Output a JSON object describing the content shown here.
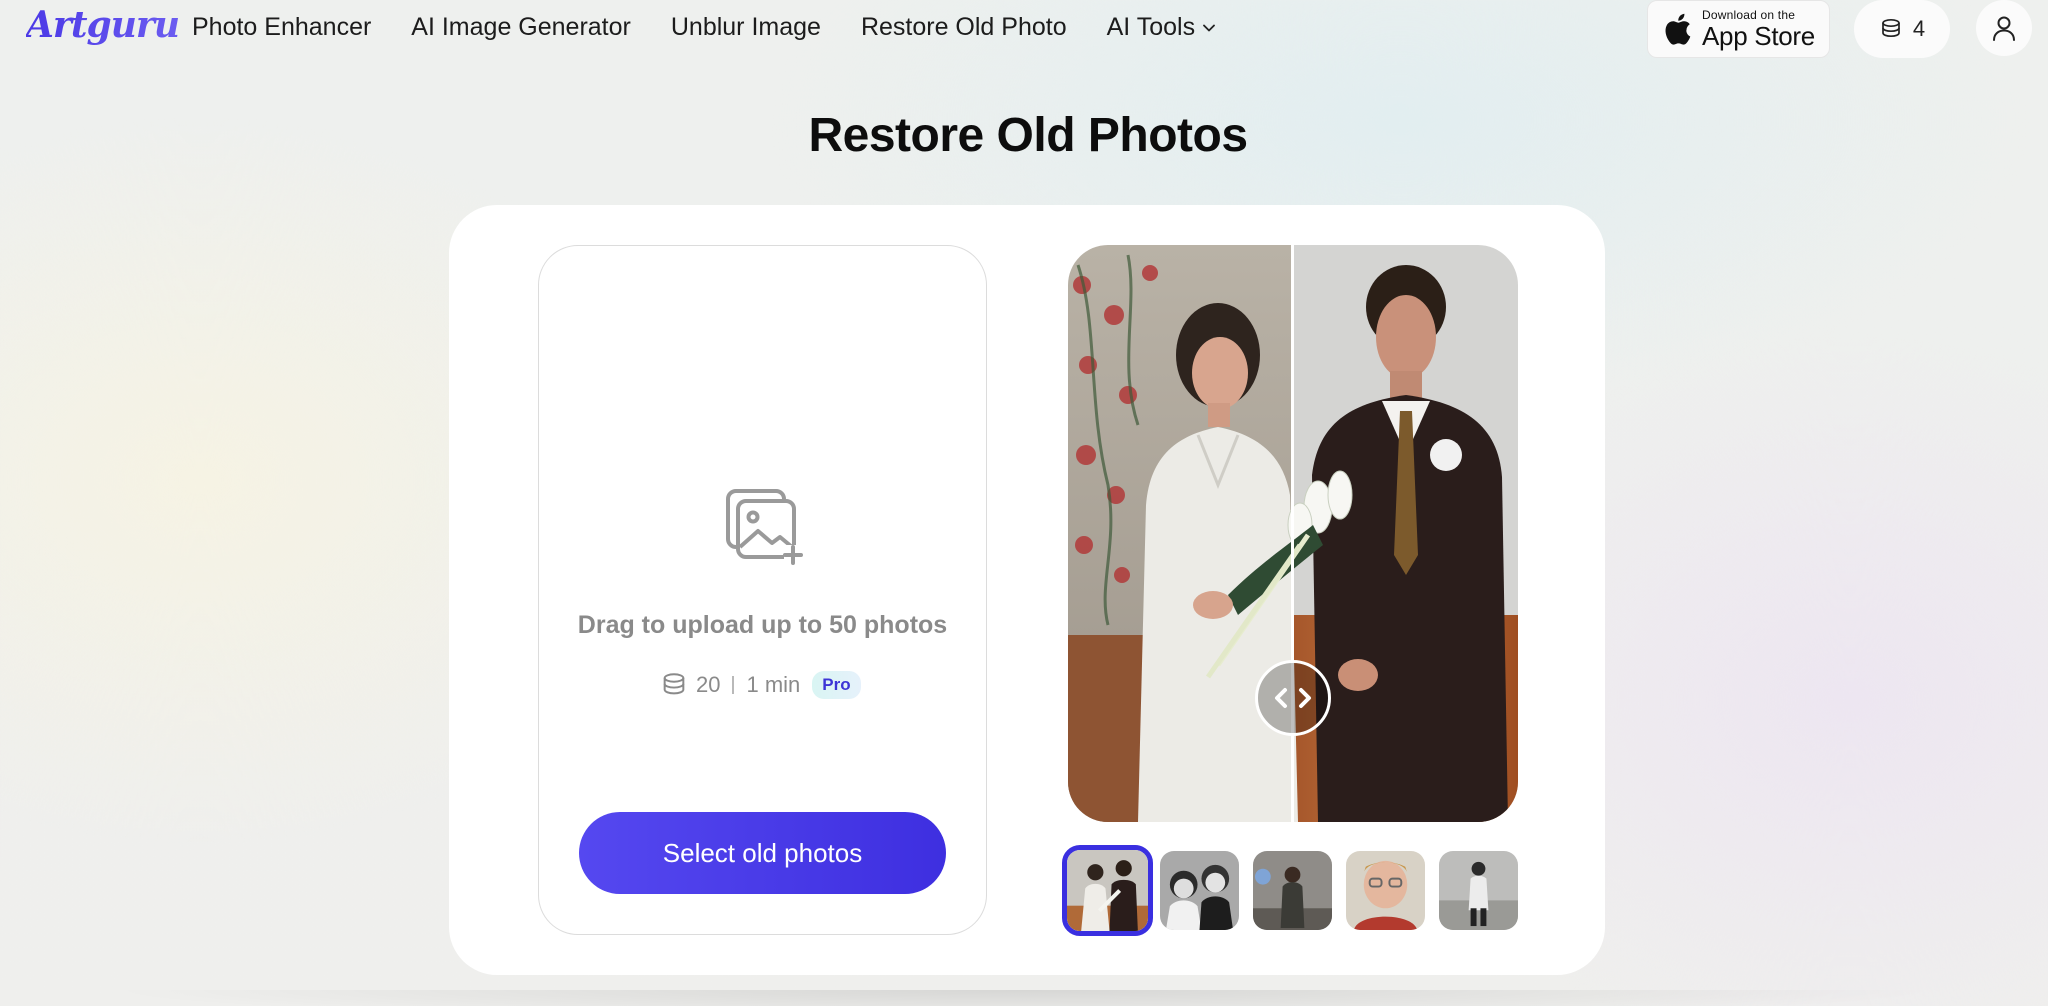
{
  "header": {
    "logo": "Artguru",
    "nav": [
      {
        "label": "Photo Enhancer"
      },
      {
        "label": "AI Image Generator"
      },
      {
        "label": "Unblur Image"
      },
      {
        "label": "Restore Old Photo"
      },
      {
        "label": "AI Tools"
      }
    ],
    "app_store": {
      "line1": "Download on the",
      "line2": "App Store"
    },
    "credits": "4"
  },
  "title": "Restore Old Photos",
  "upload": {
    "text": "Drag to upload up to 50 photos",
    "cost": "20",
    "time": "1 min",
    "badge": "Pro",
    "button": "Select old photos"
  },
  "comparison": {
    "divider_position_fraction": 0.5
  },
  "thumbnails": {
    "count": 5,
    "selected_index": 0
  },
  "colors": {
    "accent": "#4b39e6",
    "button": "#4a3ce8",
    "badge_text": "#3d35d6"
  },
  "icons": [
    "apple-icon",
    "coins-icon",
    "user-icon",
    "image-add-icon",
    "chevron-down-icon",
    "compare-handle-icon"
  ]
}
